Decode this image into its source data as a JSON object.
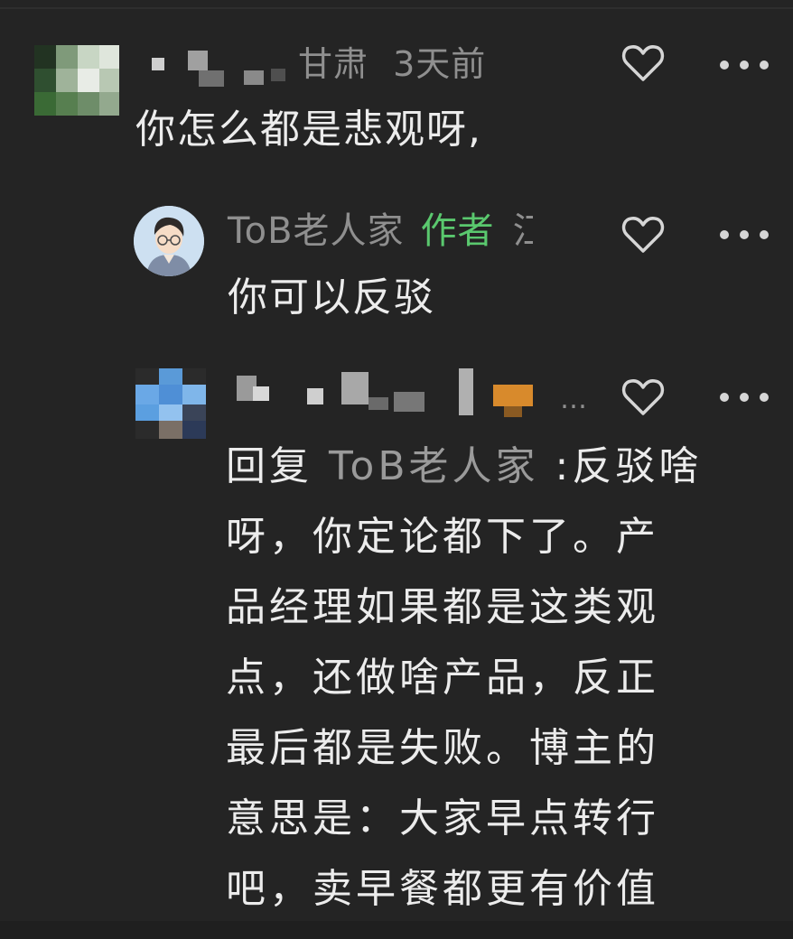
{
  "comments": [
    {
      "location": "甘肃",
      "time": "3天前",
      "text": "你怎么都是悲观呀,"
    },
    {
      "username": "ToB老人家",
      "badge": "作者",
      "location_partial": "江",
      "text": "你可以反驳"
    },
    {
      "meta_ellipsis": "…",
      "reply_prefix": "回复",
      "reply_target": "ToB老人家",
      "reply_lines": [
        ":反驳啥",
        "呀，你定论都下了。产",
        "品经理如果都是这类观",
        "点，还做啥产品，反正",
        "最后都是失败。博主的",
        "意思是：大家早点转行",
        "吧，卖早餐都更有价值"
      ]
    }
  ],
  "icons": {
    "like": "heart-outline-icon",
    "more": "more-dots-icon"
  },
  "colors": {
    "background": "#242424",
    "author_badge": "#5ac86e",
    "meta": "#8f8f8f",
    "text": "#ececec"
  }
}
